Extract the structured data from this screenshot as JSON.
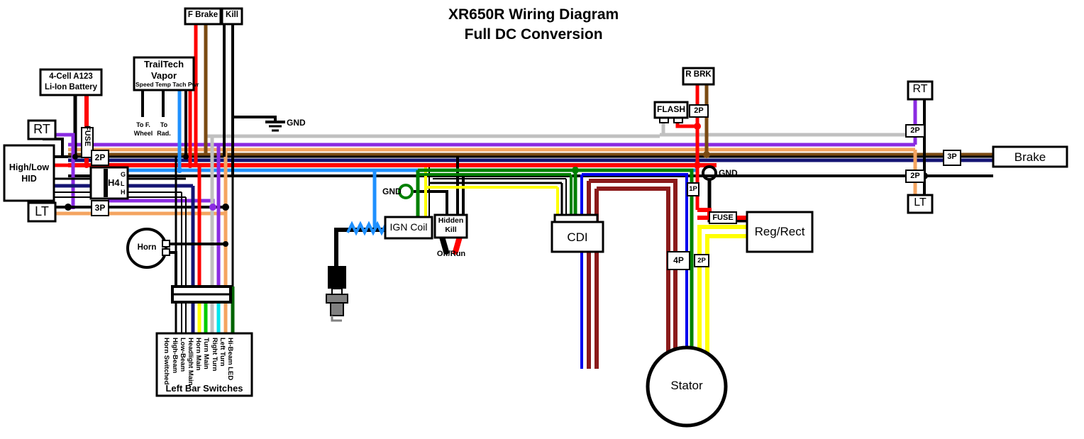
{
  "title": {
    "line1": "XR650R Wiring Diagram",
    "line2": "Full DC Conversion"
  },
  "components": {
    "battery": "4-Cell A123\nLi-Ion Battery",
    "battery_line1": "4-Cell A123",
    "battery_line2": "Li-Ion Battery",
    "vapor_line1": "TrailTech",
    "vapor_line2": "Vapor",
    "vapor_pins": "Speed Temp Tach Pwr",
    "vapor_note_1a": "To F.",
    "vapor_note_1b": "Wheel",
    "vapor_note_2a": "To",
    "vapor_note_2b": "Rad.",
    "f_brake": "F Brake",
    "kill": "Kill",
    "hid_line1": "High/Low",
    "hid_line2": "HID",
    "rt_left": "RT",
    "lt_left": "LT",
    "h4": "H4",
    "h4_pin_g": "G",
    "h4_pin_l": "L",
    "h4_pin_h": "H",
    "horn": "Horn",
    "ign_coil": "IGN Coil",
    "hidden_kill_line1": "Hidden",
    "hidden_kill_line2": "Kill",
    "off_run": "Off/Run",
    "cdi": "CDI",
    "stator": "Stator",
    "reg_rect": "Reg/Rect",
    "r_brk": "R BRK",
    "flash": "FLASH",
    "brake": "Brake",
    "rt_right": "RT",
    "lt_right": "LT",
    "left_bar_switches": "Left Bar Switches"
  },
  "connectors": {
    "fuse_left": "FUSE",
    "fuse_right": "FUSE",
    "two_p_left": "2P",
    "three_p_left": "3P",
    "two_p_rbrk": "2P",
    "one_p_cdi": "1P",
    "four_p_stator": "4P",
    "two_p_stator": "2P",
    "two_p_rt": "2P",
    "two_p_lt": "2P",
    "three_p_brake": "3P"
  },
  "ground_labels": {
    "gnd_top": "GND",
    "gnd_coil": "GND",
    "gnd_cdi": "GND"
  },
  "switch_wires": [
    "Hi-Beam LED",
    "Left Turn",
    "Right Turn",
    "Turn Main",
    "Horn Main",
    "Headlight Main",
    "Low-Beam",
    "High-Beam",
    "Horn Switched"
  ],
  "colors": {
    "black": "#000000",
    "red": "#ff0000",
    "brown": "#7a4a12",
    "orange": "#f4a460",
    "purple": "#8a2be2",
    "navy": "#141473",
    "blue": "#1e90ff",
    "gray": "#c0c0c0",
    "green": "#008000",
    "darkred": "#8b1a1a",
    "yellow": "#ffff00",
    "cyan": "#00e5ee",
    "white": "#ffffff",
    "blue_royal": "#0000ee"
  }
}
